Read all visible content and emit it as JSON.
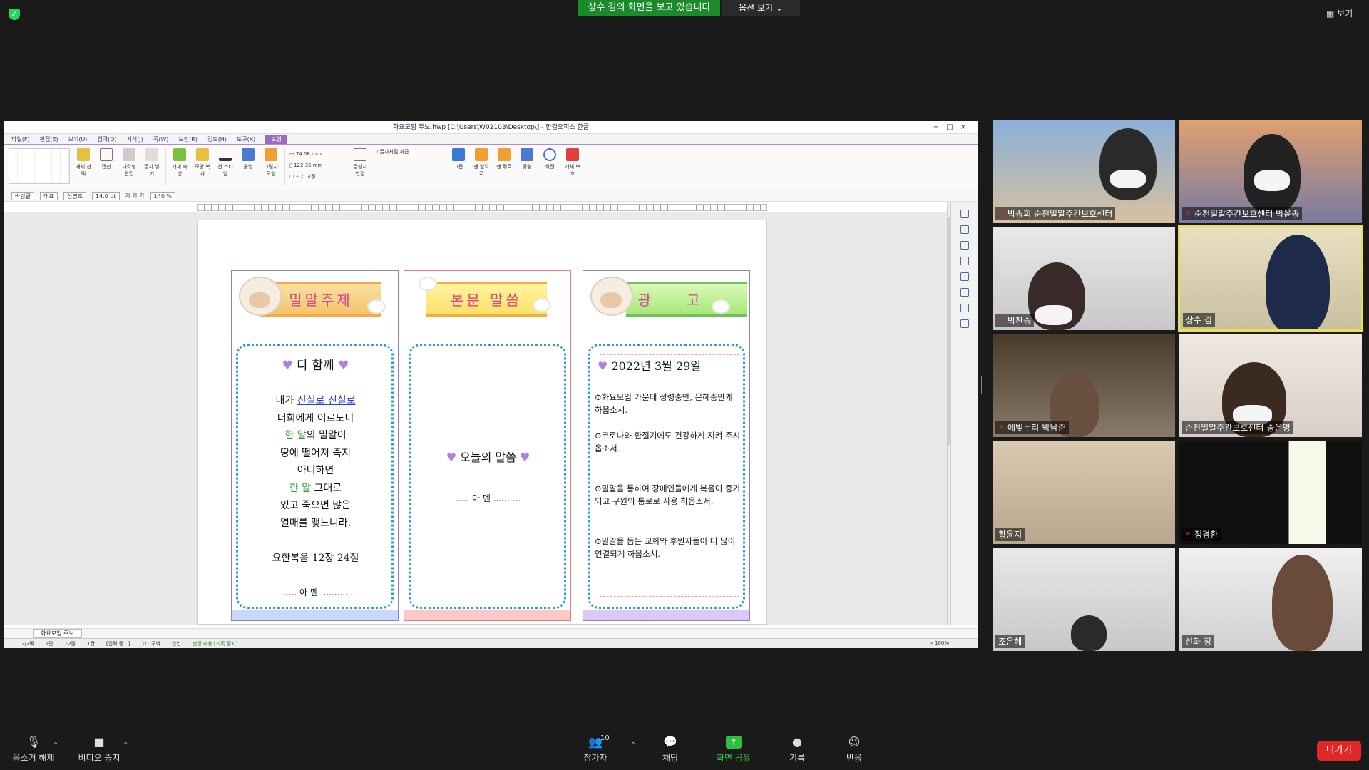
{
  "top": {
    "viewing_banner": "상수 김의 화면을 보고 있습니다",
    "view_options": "옵션 보기 ⌄",
    "view_button": "보기"
  },
  "hwp": {
    "title": "화요모임 주보.hwp [C:\\Users\\W02103\\Desktop\\] - 한컴오피스 한글",
    "menus": [
      "파일(F)",
      "편집(E)",
      "보기(U)",
      "입력(D)",
      "서식(J)",
      "쪽(W)",
      "보안(R)",
      "검토(H)",
      "도구(K)",
      "도형"
    ],
    "toolbar": {
      "items": [
        "개체 선택",
        "캡션",
        "다각형 편집",
        "글자 넣기",
        "개체 속성",
        "모양 복사",
        "선 스타일",
        "음영",
        "그림자 모양",
        "크기 고정",
        "글상자 연결",
        "그룹",
        "맨 앞으로",
        "맨 뒤로",
        "맞춤",
        "회전",
        "개체 보호"
      ],
      "width_value": "74.08",
      "height_value": "122.35",
      "unit": "mm",
      "lock_size": "크기 고정",
      "text_wrap": "글자처럼 취급"
    },
    "format": {
      "style": "바탕글",
      "lang": "대표",
      "font": "신명조",
      "size": "14.0",
      "size_unit": "pt",
      "zoom_pct": "140"
    },
    "columns": {
      "c1_title": "밀알주제",
      "c1_heading": "다 함께",
      "c1_line1_a": "내가 ",
      "c1_line1_b": "진실로 진실로",
      "c1_line2": "너희에게 이르노니",
      "c1_line3_a": "한 알",
      "c1_line3_b": "의 밀알이",
      "c1_line4": "땅에 떨어져 죽지",
      "c1_line5": "아니하면",
      "c1_line6_a": "한 알",
      "c1_line6_b": " 그대로",
      "c1_line7": "있고 죽으면 많은",
      "c1_line8": "열매를 맺느니라.",
      "c1_ref": "요한복음 12장 24절",
      "c1_amen": "..... 아 멘 ..........",
      "c2_title": "본문 말씀",
      "c2_heading": "오늘의 말씀",
      "c2_amen": "..... 아 멘 ..........",
      "c3_title": "광고",
      "c3_date": "2022년 3월 29일",
      "c3_items": [
        "⊙화요모임 가운데 성령충만, 은혜충만케 하옵소서.",
        "⊙코로나와 환절기에도 건강하게 지켜 주시옵소서.",
        "⊙밀알을 통하여 장애인들에게 복음이 증거 되고 구원의 통로로 사용 하옵소서.",
        "⊙밀알을 돕는 교회와 후원자들이 더 많이 연결되게 하옵소서."
      ]
    },
    "heart": "♥",
    "tab_name": "화요모임 주보",
    "status": [
      "2/2쪽",
      "1단",
      "12줄",
      "1칸",
      "[입력 중...]",
      "1/1 구역",
      "삽입"
    ],
    "status_change": "변경 내용 [기록 중지]",
    "zoom": "100%"
  },
  "participants": [
    {
      "name": "박송희 순천밀알주간보호센터",
      "muted": true
    },
    {
      "name": "순천밀알주간보호센터 박윤종",
      "muted": true
    },
    {
      "name": "박찬송",
      "muted": true
    },
    {
      "name": "상수 김",
      "muted": false
    },
    {
      "name": "예빛누리-박남준",
      "muted": true
    },
    {
      "name": "순천밀알주간보호센터-송은영",
      "muted": false
    },
    {
      "name": "황윤지",
      "muted": false
    },
    {
      "name": "정경환",
      "muted": true
    },
    {
      "name": "조은혜",
      "muted": false
    },
    {
      "name": "선화 정",
      "muted": false
    }
  ],
  "bottom": {
    "unmute": "음소거 해제",
    "stop_video": "비디오 중지",
    "participants": "참가자",
    "participant_count": "10",
    "chat": "채팅",
    "share": "화면 공유",
    "record": "기록",
    "reactions": "반응",
    "leave": "나가기"
  },
  "colors": {
    "share_green": "#2fbf3f",
    "leave_red": "#e02828",
    "active_speaker": "#e8e05a",
    "banner_green": "#1a8a2a"
  }
}
